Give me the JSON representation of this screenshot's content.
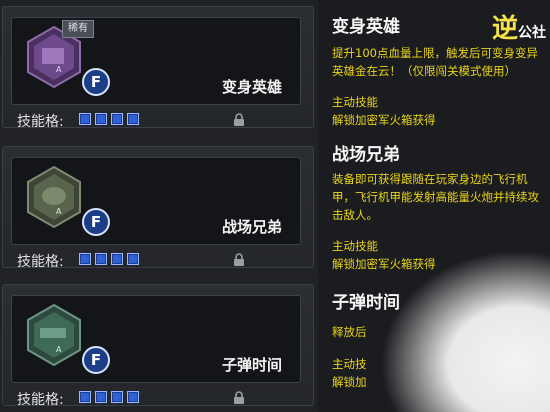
{
  "skills": [
    {
      "name": "变身英雄",
      "rarity_tag": "稀有",
      "hotkey": "F",
      "slots_label": "技能格:",
      "slots": 4,
      "badge_color": "#7c4ba0",
      "desc_title": "变身英雄",
      "desc": "提升100点血量上限，触发后可变身变异英雄金在云！（仅限闯关模式使用）",
      "type": "主动技能",
      "unlock": "解锁加密军火箱获得"
    },
    {
      "name": "战场兄弟",
      "hotkey": "F",
      "slots_label": "技能格:",
      "slots": 4,
      "badge_color": "#5e6d54",
      "desc_title": "战场兄弟",
      "desc": "装备即可获得跟随在玩家身边的飞行机甲，飞行机甲能发射高能量火炮并持续攻击敌人。",
      "type": "主动技能",
      "unlock": "解锁加密军火箱获得"
    },
    {
      "name": "子弹时间",
      "hotkey": "F",
      "slots_label": "技能格:",
      "slots": 4,
      "badge_color": "#3b6a55",
      "desc_title": "子弹时间",
      "desc": "释放后",
      "type": "主动技",
      "unlock": "解锁加"
    }
  ],
  "watermark": {
    "mark": "逆",
    "text": "公社"
  }
}
